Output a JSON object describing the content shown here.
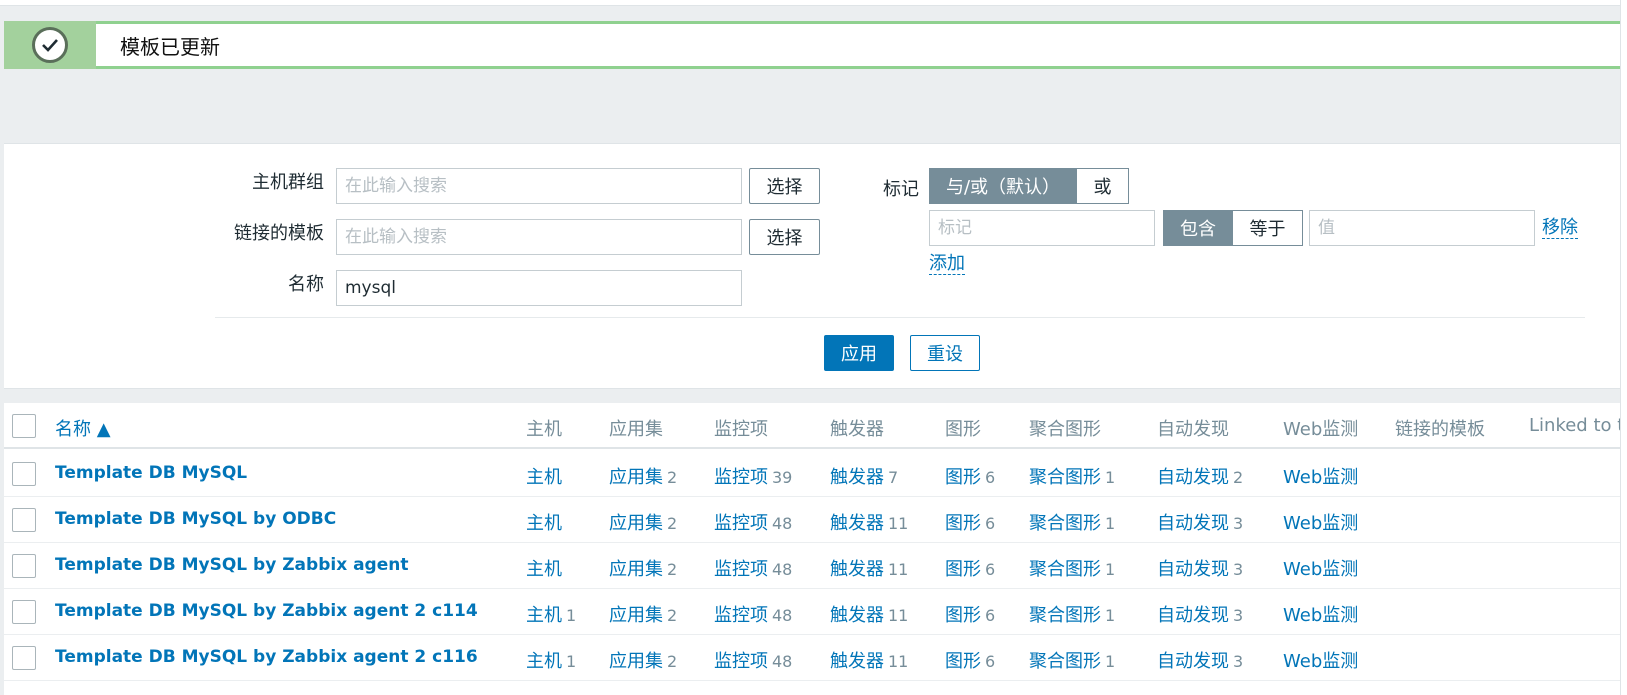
{
  "message": {
    "text": "模板已更新"
  },
  "filter": {
    "host_group_label": "主机群组",
    "host_group_placeholder": "在此输入搜索",
    "linked_templates_label": "链接的模板",
    "linked_templates_placeholder": "在此输入搜索",
    "name_label": "名称",
    "name_value": "mysql",
    "select_label": "选择",
    "tags_label": "标记",
    "tags_mode": {
      "and_or": "与/或（默认）",
      "or": "或"
    },
    "tag_placeholder": "标记",
    "tag_operator": {
      "contains": "包含",
      "equals": "等于"
    },
    "value_placeholder": "值",
    "remove_label": "移除",
    "add_label": "添加",
    "apply_label": "应用",
    "reset_label": "重设"
  },
  "table": {
    "headers": {
      "name": "名称 ▲",
      "hosts": "主机",
      "applications": "应用集",
      "items": "监控项",
      "triggers": "触发器",
      "graphs": "图形",
      "screens": "聚合图形",
      "discovery": "自动发现",
      "web": "Web监测",
      "linked_templates": "链接的模板",
      "linked_to": "Linked to te"
    },
    "rows": [
      {
        "name": "Template DB MySQL",
        "hosts": "主机",
        "hosts_count": "",
        "applications": "应用集",
        "applications_count": "2",
        "items": "监控项",
        "items_count": "39",
        "triggers": "触发器",
        "triggers_count": "7",
        "graphs": "图形",
        "graphs_count": "6",
        "screens": "聚合图形",
        "screens_count": "1",
        "discovery": "自动发现",
        "discovery_count": "2",
        "web": "Web监测"
      },
      {
        "name": "Template DB MySQL by ODBC",
        "hosts": "主机",
        "hosts_count": "",
        "applications": "应用集",
        "applications_count": "2",
        "items": "监控项",
        "items_count": "48",
        "triggers": "触发器",
        "triggers_count": "11",
        "graphs": "图形",
        "graphs_count": "6",
        "screens": "聚合图形",
        "screens_count": "1",
        "discovery": "自动发现",
        "discovery_count": "3",
        "web": "Web监测"
      },
      {
        "name": "Template DB MySQL by Zabbix agent",
        "hosts": "主机",
        "hosts_count": "",
        "applications": "应用集",
        "applications_count": "2",
        "items": "监控项",
        "items_count": "48",
        "triggers": "触发器",
        "triggers_count": "11",
        "graphs": "图形",
        "graphs_count": "6",
        "screens": "聚合图形",
        "screens_count": "1",
        "discovery": "自动发现",
        "discovery_count": "3",
        "web": "Web监测"
      },
      {
        "name": "Template DB MySQL by Zabbix agent 2 c114",
        "hosts": "主机",
        "hosts_count": "1",
        "applications": "应用集",
        "applications_count": "2",
        "items": "监控项",
        "items_count": "48",
        "triggers": "触发器",
        "triggers_count": "11",
        "graphs": "图形",
        "graphs_count": "6",
        "screens": "聚合图形",
        "screens_count": "1",
        "discovery": "自动发现",
        "discovery_count": "3",
        "web": "Web监测"
      },
      {
        "name": "Template DB MySQL by Zabbix agent 2 c116",
        "hosts": "主机",
        "hosts_count": "1",
        "applications": "应用集",
        "applications_count": "2",
        "items": "监控项",
        "items_count": "48",
        "triggers": "触发器",
        "triggers_count": "11",
        "graphs": "图形",
        "graphs_count": "6",
        "screens": "聚合图形",
        "screens_count": "1",
        "discovery": "自动发现",
        "discovery_count": "3",
        "web": "Web监测"
      }
    ]
  }
}
